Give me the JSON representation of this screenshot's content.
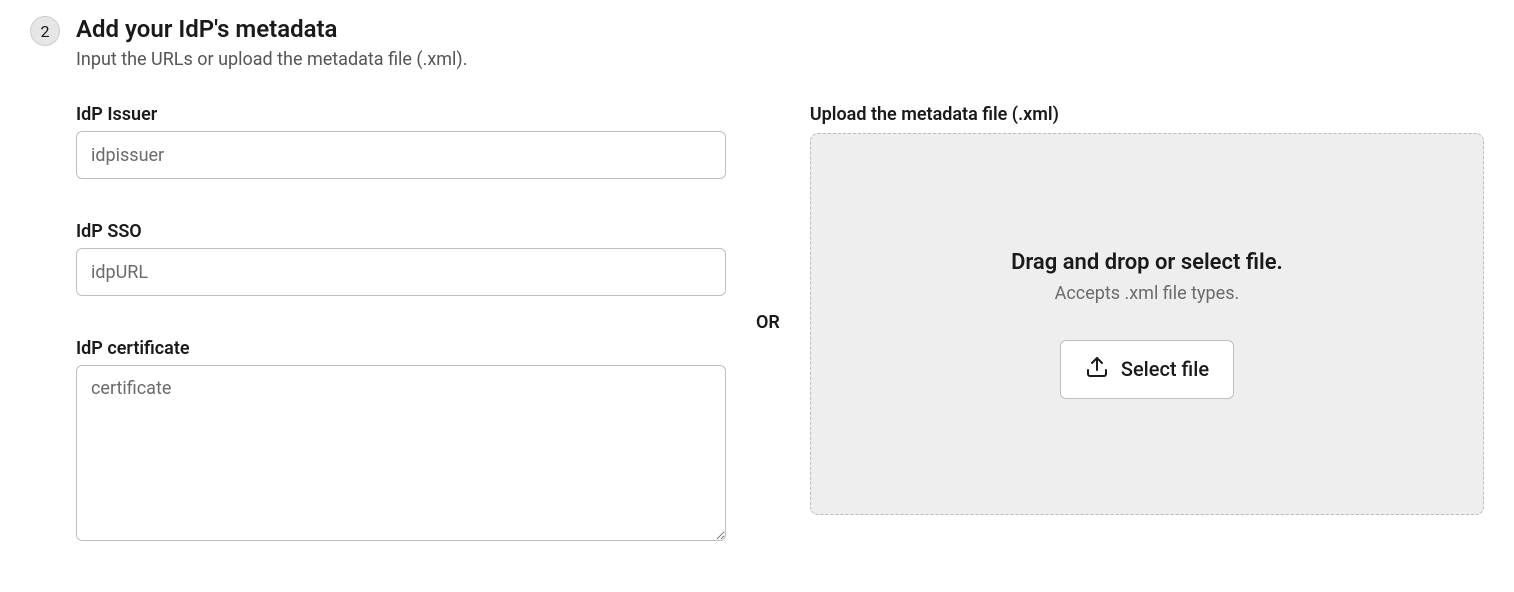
{
  "step": {
    "number": "2",
    "title": "Add your IdP's metadata",
    "subtitle": "Input the URLs or upload the metadata file (.xml)."
  },
  "fields": {
    "issuer": {
      "label": "IdP Issuer",
      "placeholder": "idpissuer",
      "value": ""
    },
    "sso": {
      "label": "IdP SSO",
      "placeholder": "idpURL",
      "value": ""
    },
    "certificate": {
      "label": "IdP certificate",
      "placeholder": "certificate",
      "value": ""
    }
  },
  "separator": "OR",
  "upload": {
    "label": "Upload the metadata file (.xml)",
    "dropzone_title": "Drag and drop or select file.",
    "dropzone_sub": "Accepts .xml file types.",
    "button_label": "Select file"
  }
}
